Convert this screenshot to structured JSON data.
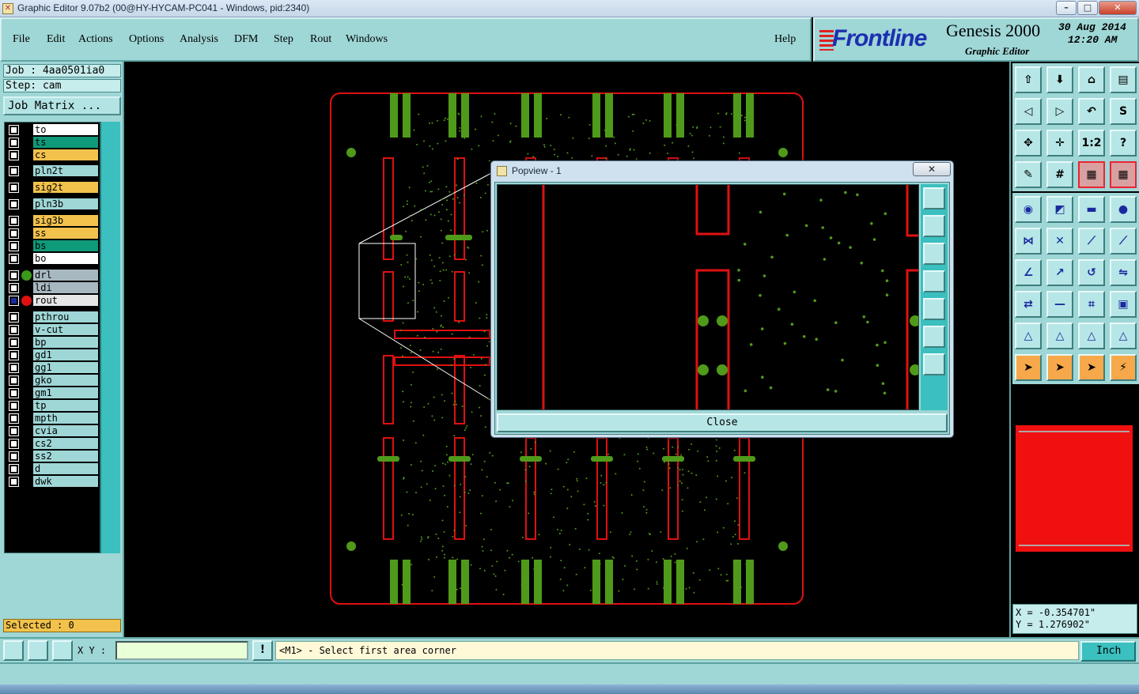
{
  "window": {
    "title": "Graphic Editor 9.07b2 (00@HY-HYCAM-PC041 - Windows, pid:2340)",
    "minimize": "–",
    "maximize": "□",
    "close": "✕"
  },
  "menu": {
    "items": [
      "File",
      "Edit",
      "Actions",
      "Options",
      "Analysis",
      "DFM",
      "Step",
      "Rout",
      "Windows"
    ],
    "help": "Help"
  },
  "logo": {
    "brand": "Frontline",
    "product": "Genesis 2000",
    "subtitle": "Graphic Editor",
    "date": "30 Aug 2014",
    "time": "12:20 AM"
  },
  "job": {
    "job_line": "Job : 4aa0501ia0",
    "step_line": "Step: cam",
    "matrix_button": "Job Matrix ..."
  },
  "layers": [
    {
      "name": "to",
      "color": "#ffffff",
      "dot": ""
    },
    {
      "name": "ts",
      "color": "#0f9a7a",
      "dot": ""
    },
    {
      "name": "cs",
      "color": "#f2c24c",
      "dot": ""
    },
    {
      "name": "pln2t",
      "color": "#9fd6d6",
      "dot": ""
    },
    {
      "name": "sig2t",
      "color": "#f2c24c",
      "dot": ""
    },
    {
      "name": "pln3b",
      "color": "#9fd6d6",
      "dot": ""
    },
    {
      "name": "sig3b",
      "color": "#f2c24c",
      "dot": ""
    },
    {
      "name": "ss",
      "color": "#f2c24c",
      "dot": ""
    },
    {
      "name": "bs",
      "color": "#0f9a7a",
      "dot": ""
    },
    {
      "name": "bo",
      "color": "#ffffff",
      "dot": ""
    },
    {
      "name": "drl",
      "color": "#a8b8c0",
      "dot": "#3a9a1a"
    },
    {
      "name": "ldi",
      "color": "#a8b8c0",
      "dot": ""
    },
    {
      "name": "rout",
      "color": "#e6e6e6",
      "dot": "#e01010"
    },
    {
      "name": "pthrou",
      "color": "#9fd6d6",
      "dot": ""
    },
    {
      "name": "v-cut",
      "color": "#9fd6d6",
      "dot": ""
    },
    {
      "name": "bp",
      "color": "#9fd6d6",
      "dot": ""
    },
    {
      "name": "gd1",
      "color": "#9fd6d6",
      "dot": ""
    },
    {
      "name": "gg1",
      "color": "#9fd6d6",
      "dot": ""
    },
    {
      "name": "gko",
      "color": "#9fd6d6",
      "dot": ""
    },
    {
      "name": "gm1",
      "color": "#9fd6d6",
      "dot": ""
    },
    {
      "name": "tp",
      "color": "#9fd6d6",
      "dot": ""
    },
    {
      "name": "mpth",
      "color": "#9fd6d6",
      "dot": ""
    },
    {
      "name": "cvia",
      "color": "#9fd6d6",
      "dot": ""
    },
    {
      "name": "cs2",
      "color": "#9fd6d6",
      "dot": ""
    },
    {
      "name": "ss2",
      "color": "#9fd6d6",
      "dot": ""
    },
    {
      "name": "d",
      "color": "#9fd6d6",
      "dot": ""
    },
    {
      "name": "dwk",
      "color": "#9fd6d6",
      "dot": ""
    }
  ],
  "selected": "Selected : 0",
  "popview": {
    "title": "Popview - 1",
    "close_x": "✕",
    "close_button": "Close"
  },
  "coords": {
    "x": "X = -0.354701\"",
    "y": "Y = 1.276902\""
  },
  "status": {
    "xy_label": "X Y :",
    "xy_value": "",
    "warn": "!",
    "message": "<M1> - Select first area corner",
    "unit": "Inch"
  },
  "colors": {
    "panel": "#9fd6d6",
    "rout": "#e01010",
    "pad": "#4f9a1a",
    "accent": "#f2c24c"
  },
  "tools": [
    "home-icon",
    "save-icon",
    "house-icon",
    "layout-icon",
    "zoom-left-icon",
    "zoom-right-icon",
    "undo-icon",
    "s-curve-icon",
    "fit-icon",
    "pan-icon",
    "scale-icon",
    "help-icon",
    "pen-icon",
    "grid-icon",
    "snap-icon",
    "snap-red-icon",
    "target-icon",
    "color-icon",
    "ruler-icon",
    "circle-icon",
    "node-icon",
    "cross-icon",
    "line-icon",
    "line2-icon",
    "angle-icon",
    "arrow-icon",
    "arc-icon",
    "mirror-icon",
    "move-icon",
    "minus-icon",
    "array-icon",
    "group-icon",
    "tri1-icon",
    "tri2-icon",
    "tri3-icon",
    "tri4-icon",
    "pointer-icon",
    "select-icon",
    "circle-select-icon",
    "net-icon"
  ]
}
